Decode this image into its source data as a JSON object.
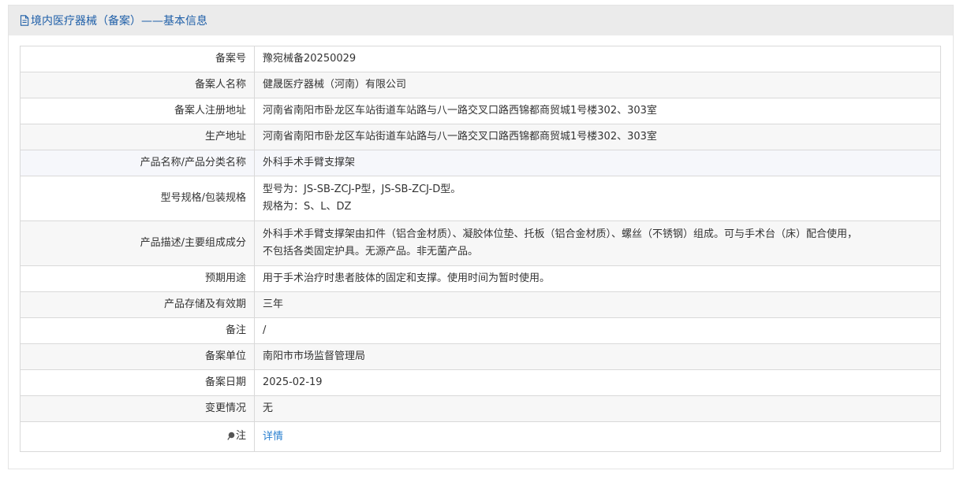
{
  "header": {
    "title": "境内医疗器械（备案）——基本信息",
    "icon": "document-icon"
  },
  "rows": [
    {
      "label": "备案号",
      "value": "豫宛械备20250029"
    },
    {
      "label": "备案人名称",
      "value": "健晟医疗器械（河南）有限公司"
    },
    {
      "label": "备案人注册地址",
      "value": "河南省南阳市卧龙区车站街道车站路与八一路交叉口路西锦都商贸城1号楼302、303室"
    },
    {
      "label": "生产地址",
      "value": "河南省南阳市卧龙区车站街道车站路与八一路交叉口路西锦都商贸城1号楼302、303室"
    },
    {
      "label": "产品名称/产品分类名称",
      "value": "外科手术手臂支撑架"
    },
    {
      "label": "型号规格/包装规格",
      "value_line1": "型号为：JS-SB-ZCJ-P型，JS-SB-ZCJ-D型。",
      "value_line2": "规格为：S、L、DZ"
    },
    {
      "label": "产品描述/主要组成成分",
      "value_line1": "外科手术手臂支撑架由扣件（铝合金材质）、凝胶体位垫、托板（铝合金材质）、螺丝（不锈钢）组成。可与手术台（床）配合使用，",
      "value_line2": "不包括各类固定护具。无源产品。非无菌产品。"
    },
    {
      "label": "预期用途",
      "value": "用于手术治疗时患者肢体的固定和支撑。使用时间为暂时使用。"
    },
    {
      "label": "产品存储及有效期",
      "value": "三年"
    },
    {
      "label": "备注",
      "value": "/"
    },
    {
      "label": "备案单位",
      "value": "南阳市市场监督管理局"
    },
    {
      "label": "备案日期",
      "value": "2025-02-19"
    },
    {
      "label": "变更情况",
      "value": "无"
    },
    {
      "label": "注",
      "value": "详情",
      "icon": "pin-icon"
    }
  ],
  "colors": {
    "header_text": "#1f5fa8",
    "link": "#2a80d0",
    "header_bg": "#ebebeb"
  }
}
